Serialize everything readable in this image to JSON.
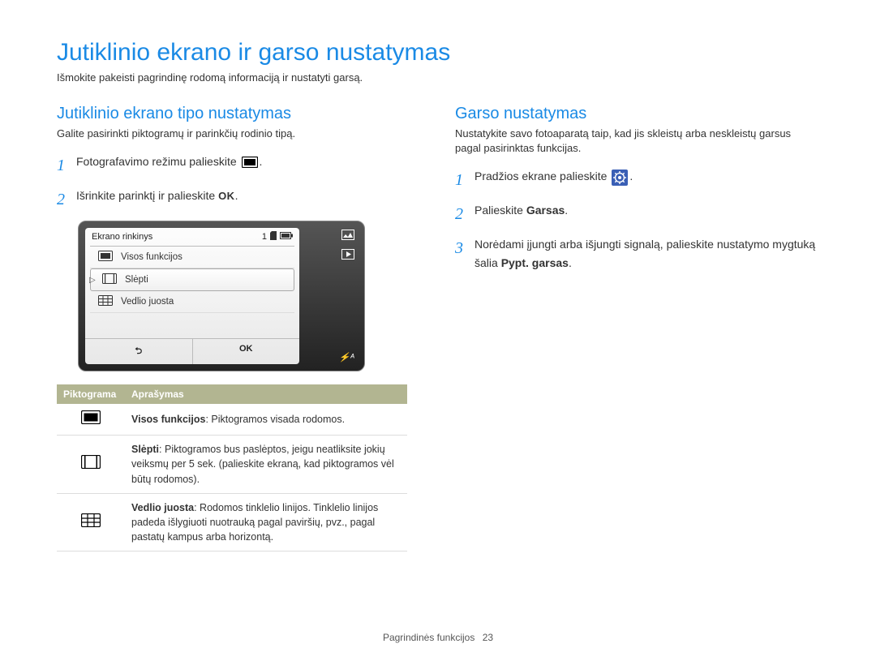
{
  "page_title": "Jutiklinio ekrano ir garso nustatymas",
  "intro": "Išmokite pakeisti pagrindinę rodomą informaciją ir nustatyti garsą.",
  "left": {
    "heading": "Jutiklinio ekrano tipo nustatymas",
    "desc": "Galite pasirinkti piktogramų ir parinkčių rodinio tipą.",
    "step1": "Fotografavimo režimu palieskite",
    "step2": "Išrinkite parinktį ir palieskite",
    "ok": "OK",
    "lcd": {
      "title": "Ekrano rinkinys",
      "count": "1",
      "items": [
        "Visos funkcijos",
        "Slėpti",
        "Vedlio juosta"
      ],
      "back": "↶",
      "ok": "OK"
    },
    "table": {
      "col1": "Piktograma",
      "col2": "Aprašymas",
      "row1_bold": "Visos funkcijos",
      "row1_rest": ": Piktogramos visada rodomos.",
      "row2_bold": "Slėpti",
      "row2_rest": ": Piktogramos bus paslėptos, jeigu neatliksite jokių veiksmų per 5 sek. (palieskite ekraną, kad piktogramos vėl būtų rodomos).",
      "row3_bold": "Vedlio juosta",
      "row3_rest": ": Rodomos tinklelio linijos. Tinklelio linijos padeda išlygiuoti nuotrauką pagal paviršių, pvz., pagal pastatų kampus arba horizontą."
    }
  },
  "right": {
    "heading": "Garso nustatymas",
    "desc": "Nustatykite savo fotoaparatą taip, kad jis skleistų arba neskleistų garsus pagal pasirinktas funkcijas.",
    "step1": "Pradžios ekrane palieskite",
    "step2_pre": "Palieskite ",
    "step2_bold": "Garsas",
    "step2_post": ".",
    "step3_pre": "Norėdami įjungti arba išjungti signalą, palieskite nustatymo mygtuką šalia ",
    "step3_bold": "Pypt. garsas",
    "step3_post": "."
  },
  "footer": {
    "section": "Pagrindinės funkcijos",
    "page": "23"
  }
}
